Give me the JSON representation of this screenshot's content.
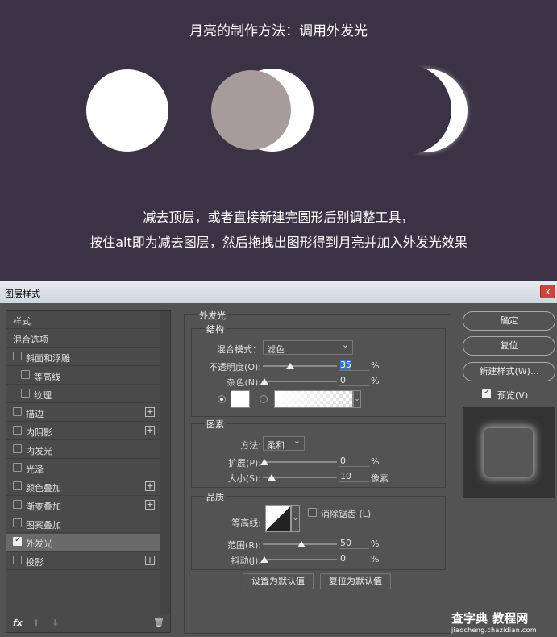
{
  "banner": {
    "title": "月亮的制作方法：调用外发光",
    "caption_line1": "减去顶层，或者直接新建完圆形后别调整工具，",
    "caption_line2": "按住alt即为减去图层，然后拖拽出图形得到月亮并加入外发光效果"
  },
  "window": {
    "title": "图层样式",
    "close": "x"
  },
  "styles_list": {
    "items": [
      {
        "label": "样式",
        "checkbox": false,
        "plus": false
      },
      {
        "label": "混合选项",
        "checkbox": false,
        "plus": false
      },
      {
        "label": "斜面和浮雕",
        "checkbox": true,
        "checked": false,
        "plus": false
      },
      {
        "label": "等高线",
        "checkbox": true,
        "checked": false,
        "plus": false,
        "indent": true
      },
      {
        "label": "纹理",
        "checkbox": true,
        "checked": false,
        "plus": false,
        "indent": true
      },
      {
        "label": "描边",
        "checkbox": true,
        "checked": false,
        "plus": true
      },
      {
        "label": "内阴影",
        "checkbox": true,
        "checked": false,
        "plus": true
      },
      {
        "label": "内发光",
        "checkbox": true,
        "checked": false,
        "plus": false
      },
      {
        "label": "光泽",
        "checkbox": true,
        "checked": false,
        "plus": false
      },
      {
        "label": "颜色叠加",
        "checkbox": true,
        "checked": false,
        "plus": true
      },
      {
        "label": "渐变叠加",
        "checkbox": true,
        "checked": false,
        "plus": true
      },
      {
        "label": "图案叠加",
        "checkbox": true,
        "checked": false,
        "plus": false
      },
      {
        "label": "外发光",
        "checkbox": true,
        "checked": true,
        "plus": false,
        "selected": true
      },
      {
        "label": "投影",
        "checkbox": true,
        "checked": false,
        "plus": true
      }
    ],
    "footer": {
      "fx": "fx",
      "up": "⬆",
      "down": "⬇",
      "trash": "🗑"
    }
  },
  "outer_glow": {
    "section_title": "外发光",
    "structure": {
      "title": "结构",
      "blend_label": "混合模式：",
      "blend_value": "滤色",
      "opacity_label": "不透明度(O):",
      "opacity_value": "35",
      "noise_label": "杂色(N):",
      "noise_value": "0",
      "percent": "%"
    },
    "elements": {
      "title": "图素",
      "method_label": "方法:",
      "method_value": "柔和",
      "spread_label": "扩展(P):",
      "spread_value": "0",
      "size_label": "大小(S):",
      "size_value": "10",
      "size_unit": "像素",
      "percent": "%"
    },
    "quality": {
      "title": "品质",
      "contour_label": "等高线:",
      "antialias_label": "消除锯齿 (L)",
      "range_label": "范围(R):",
      "range_value": "50",
      "jitter_label": "抖动(J):",
      "jitter_value": "0",
      "percent": "%"
    },
    "set_default": "设置为默认值",
    "reset_default": "复位为默认值",
    "opacity_level": 0.35,
    "range_level": 0.5,
    "size_level": 0.1
  },
  "right_panel": {
    "ok": "确定",
    "reset": "复位",
    "new_style": "新建样式(W)...",
    "preview_label": "预览(V)"
  },
  "watermark": {
    "main": "查字典 教程网",
    "sub": "jiaocheng.chazidian.com"
  }
}
